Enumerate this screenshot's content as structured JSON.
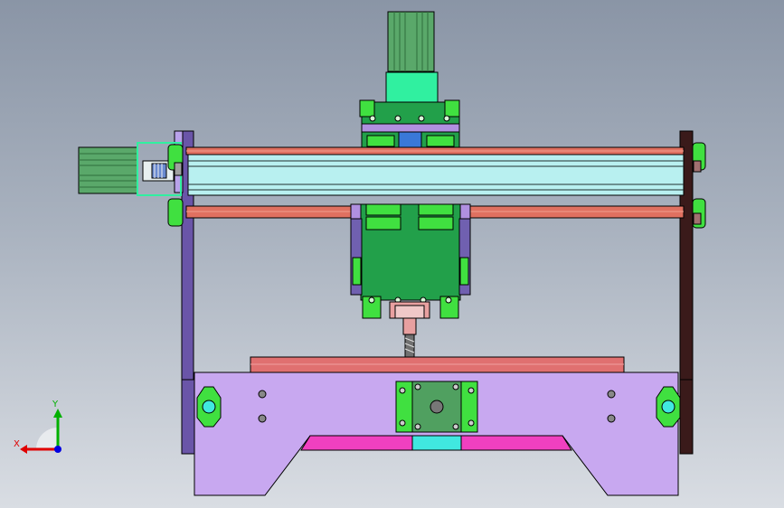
{
  "viewport": {
    "background_top": "#8a95a6",
    "background_bottom": "#d9dde3"
  },
  "triad": {
    "x_label": "X",
    "y_label": "Y",
    "x_color": "#e00000",
    "y_color": "#00b000",
    "z_color": "#0000e0"
  },
  "model": {
    "frame_color": "#c8a8f0",
    "gantry_plate_color": "#20a050",
    "rail_color": "#e07060",
    "beam_color": "#b8f0f0",
    "motor_color": "#50a060",
    "slot_color": "#f040c0"
  }
}
